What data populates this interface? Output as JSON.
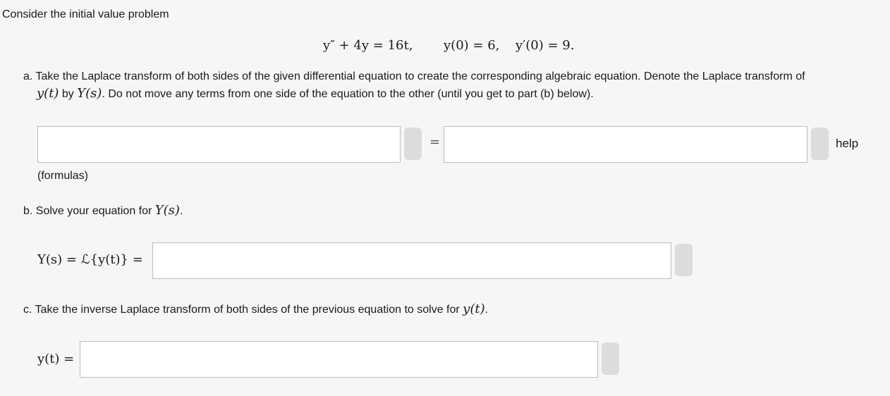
{
  "intro": "Consider the initial value problem",
  "equation": {
    "ode": "y″ + 4y = 16t,",
    "ic1": "y(0) = 6,",
    "ic2": "y′(0) = 9."
  },
  "part_a": {
    "text_line1": "a. Take the Laplace transform of both sides of the given differential equation to create the corresponding algebraic equation. Denote the Laplace transform of",
    "yt": "y(t)",
    "by": " by ",
    "Ys": "Y(s)",
    "text_line2_rest": ". Do not move any terms from one side of the equation to the other (until you get to part (b) below).",
    "left_value": "",
    "equals": "=",
    "right_value": "",
    "help_label": "help",
    "formulas_label": "(formulas)"
  },
  "part_b": {
    "text": "b. Solve your equation for ",
    "Ys": "Y(s)",
    "period": ".",
    "lhs": "Y(s) = ℒ{y(t)} =",
    "answer_value": ""
  },
  "part_c": {
    "text": "c. Take the inverse Laplace transform of both sides of the previous equation to solve for ",
    "yt": "y(t)",
    "period": ".",
    "lhs": "y(t) =",
    "answer_value": ""
  }
}
